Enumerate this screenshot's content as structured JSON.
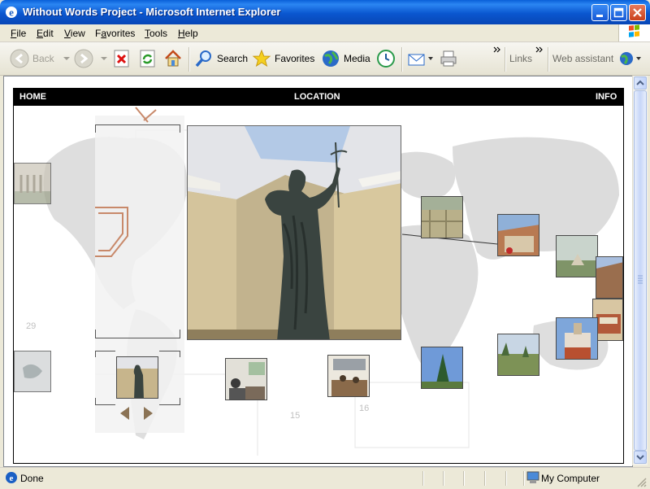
{
  "window": {
    "title": "Without Words Project - Microsoft Internet Explorer"
  },
  "menu": {
    "file": {
      "key": "F",
      "rest": "ile"
    },
    "edit": {
      "key": "E",
      "rest": "dit"
    },
    "view": {
      "key": "V",
      "rest": "iew"
    },
    "favorites": {
      "pre": "F",
      "key": "a",
      "rest": "vorites"
    },
    "tools": {
      "key": "T",
      "rest": "ools"
    },
    "help": {
      "key": "H",
      "rest": "elp"
    }
  },
  "toolbar": {
    "back": "Back",
    "search": "Search",
    "favorites": "Favorites",
    "media": "Media",
    "links": "Links",
    "web_assistant": "Web assistant"
  },
  "page": {
    "nav": {
      "home": "HOME",
      "location": "LOCATION",
      "info": "INFO"
    },
    "map_numbers": {
      "n29": "29",
      "n15": "15",
      "n16": "16"
    }
  },
  "status": {
    "left": "Done",
    "zone": "My Computer"
  },
  "colors": {
    "accent": "#0a5fd8",
    "arrow": "#8b7355",
    "map": "#d8d8d8"
  }
}
